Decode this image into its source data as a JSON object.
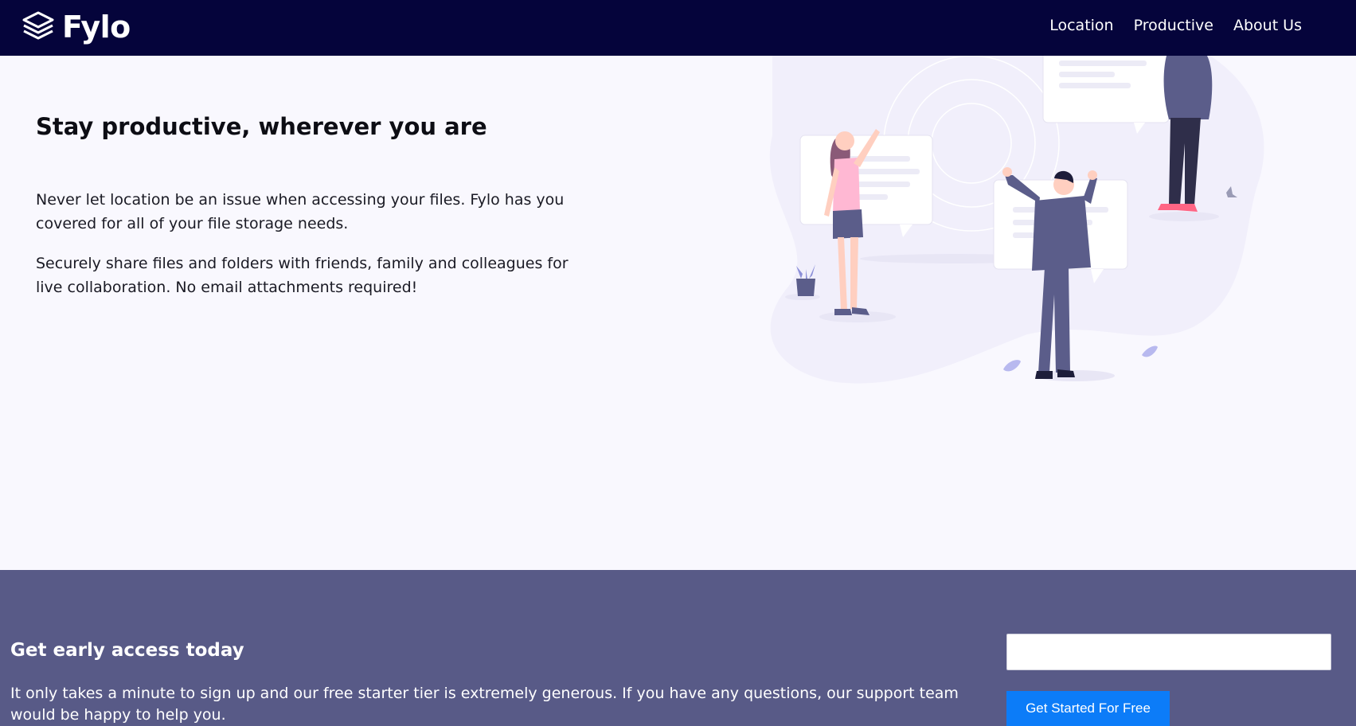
{
  "brand": {
    "name": "Fylo",
    "logo_icon": "layers-icon"
  },
  "nav": {
    "items": [
      {
        "label": "Location"
      },
      {
        "label": "Productive"
      },
      {
        "label": "About Us"
      }
    ]
  },
  "hero": {
    "title": "Stay productive, wherever you are",
    "paragraphs": [
      "Never let location be an issue when accessing your files. Fylo has you covered for all of your file storage needs.",
      "Securely share files and folders with friends, family and colleagues for live collaboration. No email attachments required!"
    ],
    "illustration": "people-collaborating-illustration"
  },
  "cta": {
    "title": "Get early access today",
    "text": "It only takes a minute to sign up and our free starter tier is extremely generous. If you have any questions, our support team would be happy to help you.",
    "email_value": "",
    "email_placeholder": "",
    "button_label": "Get Started For Free"
  },
  "colors": {
    "navbar_bg": "#05043b",
    "hero_bg": "#f9f8fe",
    "cta_bg": "#585a87",
    "button_bg": "#0c7cf8"
  }
}
